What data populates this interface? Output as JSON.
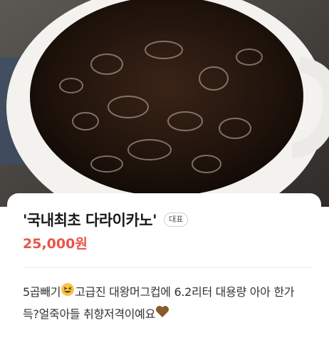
{
  "menu_item": {
    "name": "'국내최초 다라이카노'",
    "badge": "대표",
    "price": "25,000원",
    "description_part1": "5곱빼기",
    "description_part2": "고급진 대왕머그컵에 6.2리터 대용량 아아 한가득?얼죽아들 취향저격이예요",
    "emoji_1": "laughing-squint-face-icon",
    "emoji_2": "brown-heart-icon"
  },
  "colors": {
    "price": "#e8544a",
    "title": "#1a1a1a",
    "card_bg": "#ffffff"
  },
  "photo": {
    "subject": "iced-americano-in-large-mug-image"
  }
}
